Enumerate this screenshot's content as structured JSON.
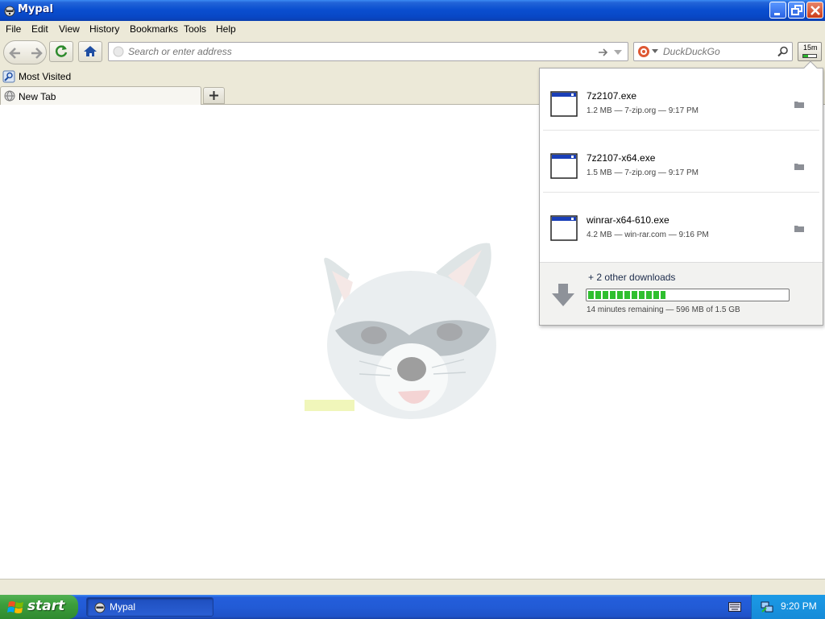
{
  "window": {
    "title": "Mypal"
  },
  "menu": {
    "items": [
      "File",
      "Edit",
      "View",
      "History",
      "Bookmarks",
      "Tools",
      "Help"
    ]
  },
  "navbar": {
    "address_placeholder": "Search or enter address",
    "search_placeholder": "DuckDuckGo",
    "download_indicator": "15m",
    "download_progress_percent": 40
  },
  "bookmarks": {
    "items": [
      {
        "label": "Most Visited"
      }
    ]
  },
  "tabs": [
    {
      "label": "New Tab"
    }
  ],
  "downloads": {
    "items": [
      {
        "filename": "7z2107.exe",
        "meta": "1.2 MB — 7-zip.org — 9:17 PM"
      },
      {
        "filename": "7z2107-x64.exe",
        "meta": "1.5 MB — 7-zip.org — 9:17 PM"
      },
      {
        "filename": "winrar-x64-610.exe",
        "meta": "4.2 MB — win-rar.com — 9:16 PM"
      }
    ],
    "summary": {
      "other": "+ 2 other downloads",
      "progress_percent": 39,
      "remaining": "14 minutes remaining — 596 MB of 1.5 GB"
    }
  },
  "taskbar": {
    "start_label": "start",
    "items": [
      {
        "label": "Mypal"
      }
    ],
    "clock": "9:20 PM"
  },
  "colors": {
    "titlebar": "#0a4fd0",
    "chrome": "#ece9d8",
    "progress": "#2fbf2f",
    "taskbar": "#225bd6",
    "start": "#3c9e3c"
  }
}
